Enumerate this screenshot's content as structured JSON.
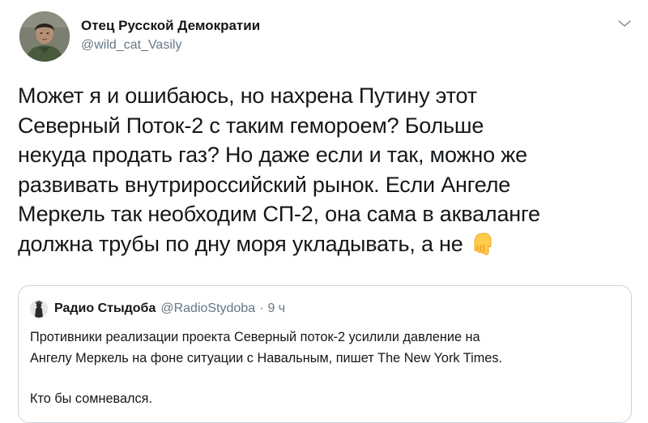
{
  "tweet": {
    "author": {
      "display_name": "Отец Русской Демократии",
      "handle": "@wild_cat_Vasily",
      "avatar_icon": "portrait-photo-icon"
    },
    "menu_icon": "chevron-down-icon",
    "text_lines": [
      "Может я и ошибаюсь, но нахрена Путину этот",
      "Северный Поток-2 с таким гемороем? Больше",
      "некуда продать газ? Но даже если и так, можно же",
      "развивать внутрироссийский рынок. Если Ангеле",
      "Меркель так необходим СП-2, она сама в акваланге",
      "должна трубы по дну моря укладывать, а не"
    ],
    "trailing_emoji": "pointing-down-hand-emoji"
  },
  "quoted_tweet": {
    "author_name": "Радио Стыдоба",
    "handle": "@RadioStydoba",
    "separator": "·",
    "time": "9 ч",
    "avatar_icon": "statue-avatar-icon",
    "text_lines": [
      "Противники реализации проекта Северный поток-2 усилили давление на",
      "Ангелу Меркель на фоне ситуации с Навальным, пишет The New York Times."
    ],
    "text_tail": "Кто бы сомневался."
  },
  "colors": {
    "text_primary": "#14171a",
    "text_secondary": "#657786",
    "border": "#ccd6dd"
  }
}
